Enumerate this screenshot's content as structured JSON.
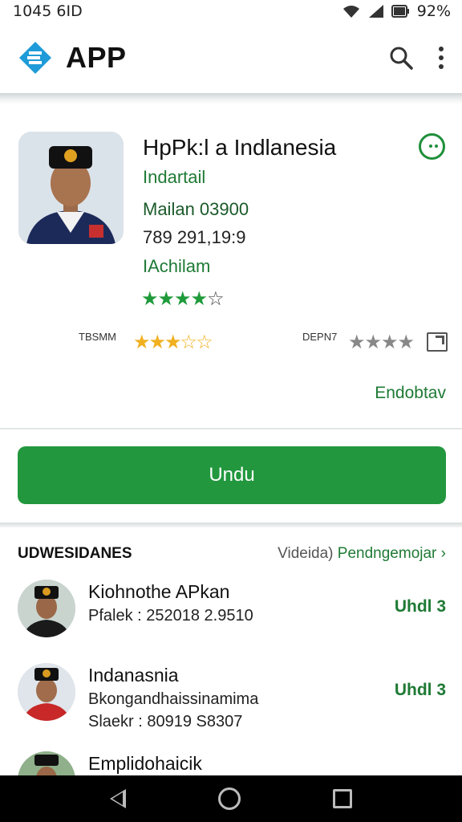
{
  "status_bar": {
    "time": "1045 6ID",
    "battery": "92%"
  },
  "app_bar": {
    "title": "APP",
    "icons": [
      "search-icon",
      "more-vert-icon"
    ]
  },
  "app_card": {
    "name": "HpPk:l a Indlanesia",
    "developer": "Indartail",
    "meta_line1": "Mailan 03900",
    "meta_line2": "789 291,19:9",
    "category": "IAchilam",
    "rating_stars": 4,
    "rating_left_label": "TBSMM",
    "rating_left_stars": 3.5,
    "rating_right_label": "DEPN7",
    "rating_right_stars": 4,
    "link_text": "Endobtav",
    "colors": {
      "accent": "#22973e",
      "stars_yellow": "#f0b020"
    }
  },
  "install_button": {
    "label": "Undu"
  },
  "section": {
    "title": "UDWESIDANES",
    "right_text": "Videida)",
    "right_link": "Pendngemojar"
  },
  "list": [
    {
      "title": "Kiohnothe APkan",
      "sub1": "Pfalek : 252018 2.9510",
      "sub2": "",
      "action": "Uhdl 3"
    },
    {
      "title": "Indanasnia",
      "sub1": "Bkongandhaissinamima",
      "sub2": "Slaekr : 80919 S8307",
      "action": "Uhdl 3"
    },
    {
      "title": "Emplidohaicik",
      "sub1": "",
      "sub2": "",
      "action": ""
    }
  ]
}
